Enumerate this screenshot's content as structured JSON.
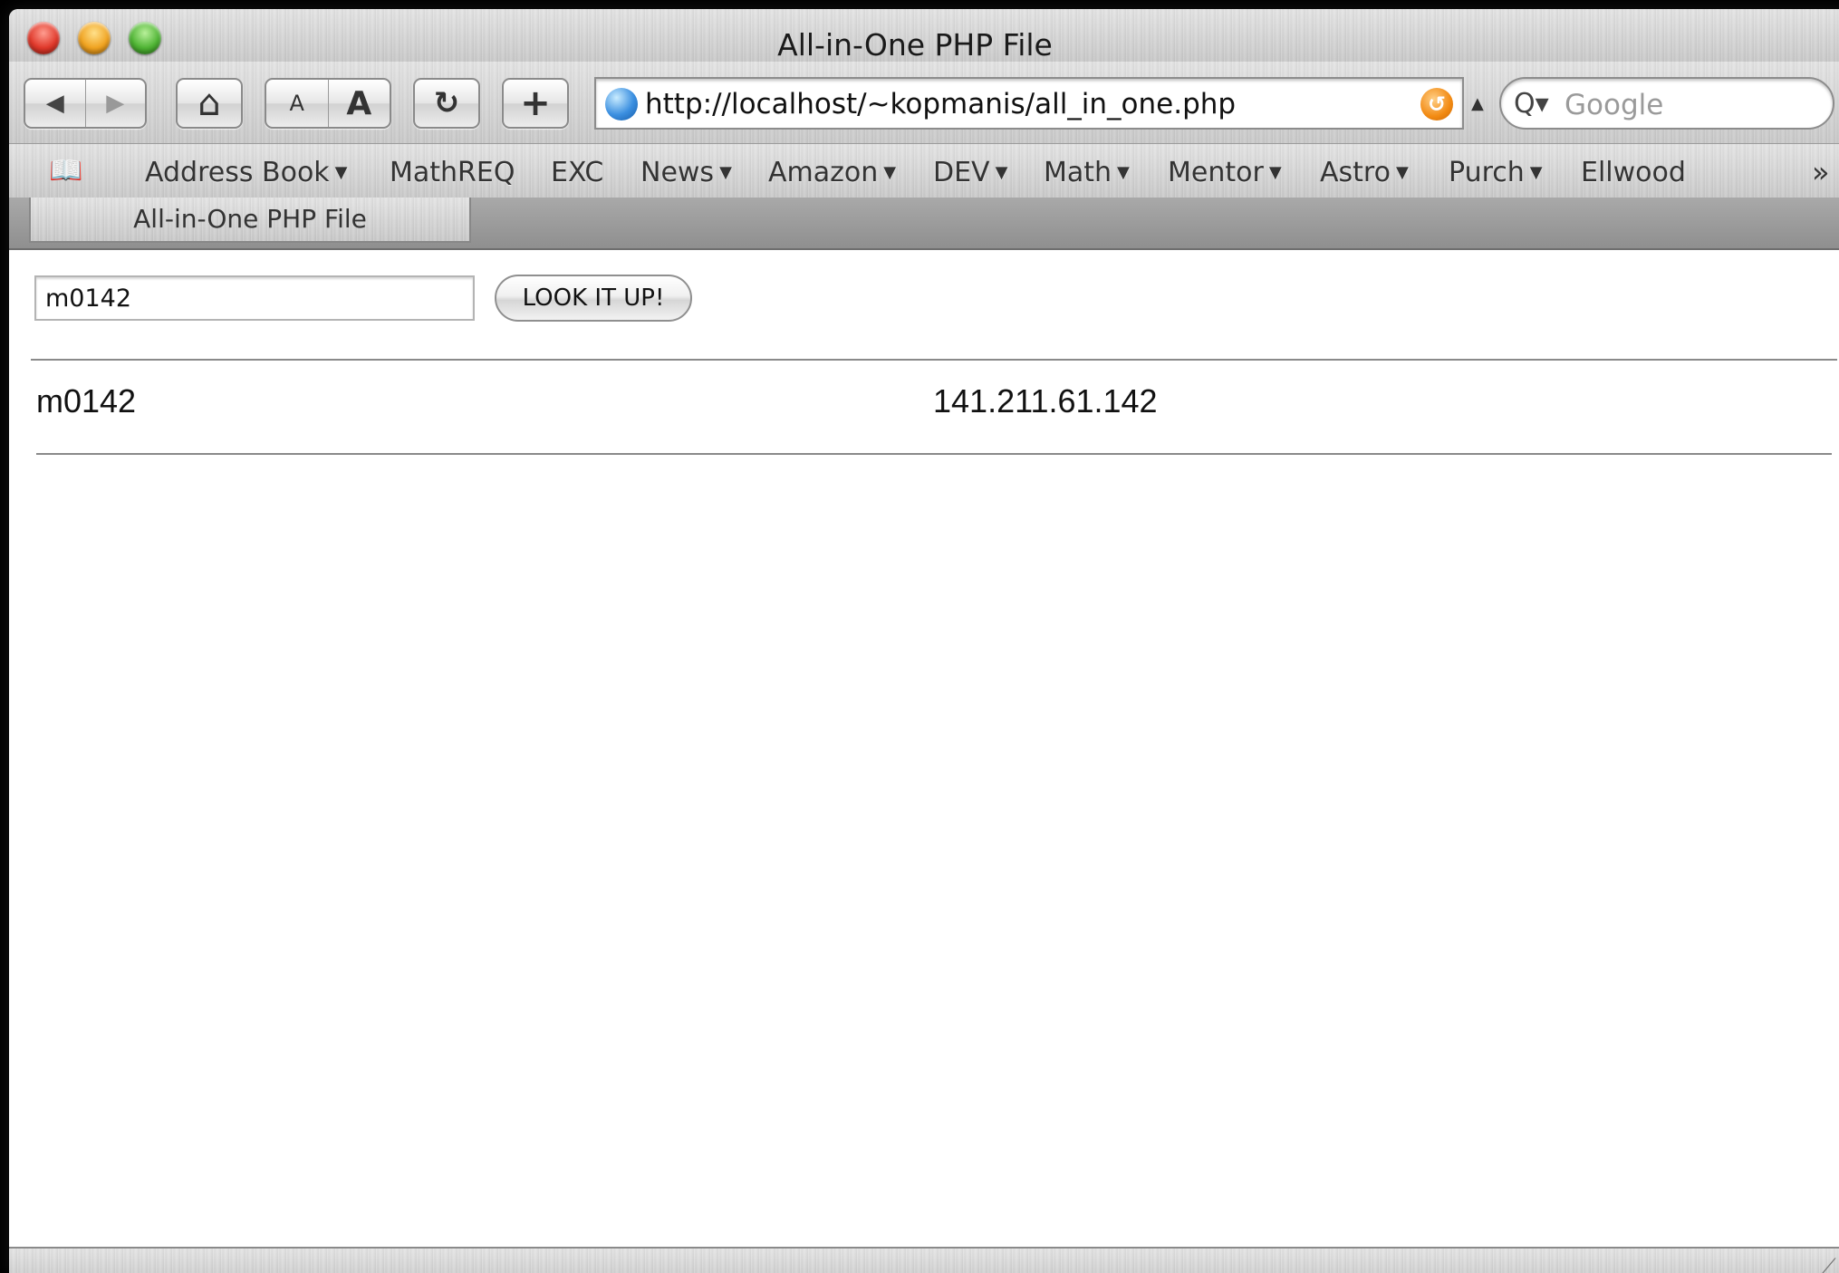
{
  "window": {
    "title": "All-in-One PHP File"
  },
  "toolbar": {
    "back_glyph": "◀",
    "forward_glyph": "▶",
    "home_glyph": "⌂",
    "text_smaller_label": "A",
    "text_bigger_label": "A",
    "reload_glyph": "↻",
    "add_bookmark_glyph": "+",
    "url": "http://localhost/~kopmanis/all_in_one.php",
    "snapback_glyph": "↺",
    "search_placeholder": "Google"
  },
  "bookmarks": {
    "items": [
      {
        "label": "Address Book",
        "has_menu": true
      },
      {
        "label": "MathREQ",
        "has_menu": false
      },
      {
        "label": "EXC",
        "has_menu": false
      },
      {
        "label": "News",
        "has_menu": true
      },
      {
        "label": "Amazon",
        "has_menu": true
      },
      {
        "label": "DEV",
        "has_menu": true
      },
      {
        "label": "Math",
        "has_menu": true
      },
      {
        "label": "Mentor",
        "has_menu": true
      },
      {
        "label": "Astro",
        "has_menu": true
      },
      {
        "label": "Purch",
        "has_menu": true
      },
      {
        "label": "Ellwood",
        "has_menu": false
      }
    ],
    "more_glyph": "»"
  },
  "tabs": [
    {
      "label": "All-in-One PHP File"
    }
  ],
  "page": {
    "input_value": "m0142",
    "button_label": "LOOK IT UP!",
    "result_host": "m0142",
    "result_ip": "141.211.61.142"
  },
  "icons": {
    "close": "close-icon",
    "minimize": "minimize-icon",
    "zoom": "zoom-icon",
    "globe": "globe-icon",
    "rss": "rss-icon",
    "search": "search-icon",
    "bookmarks_book": "book-icon"
  }
}
